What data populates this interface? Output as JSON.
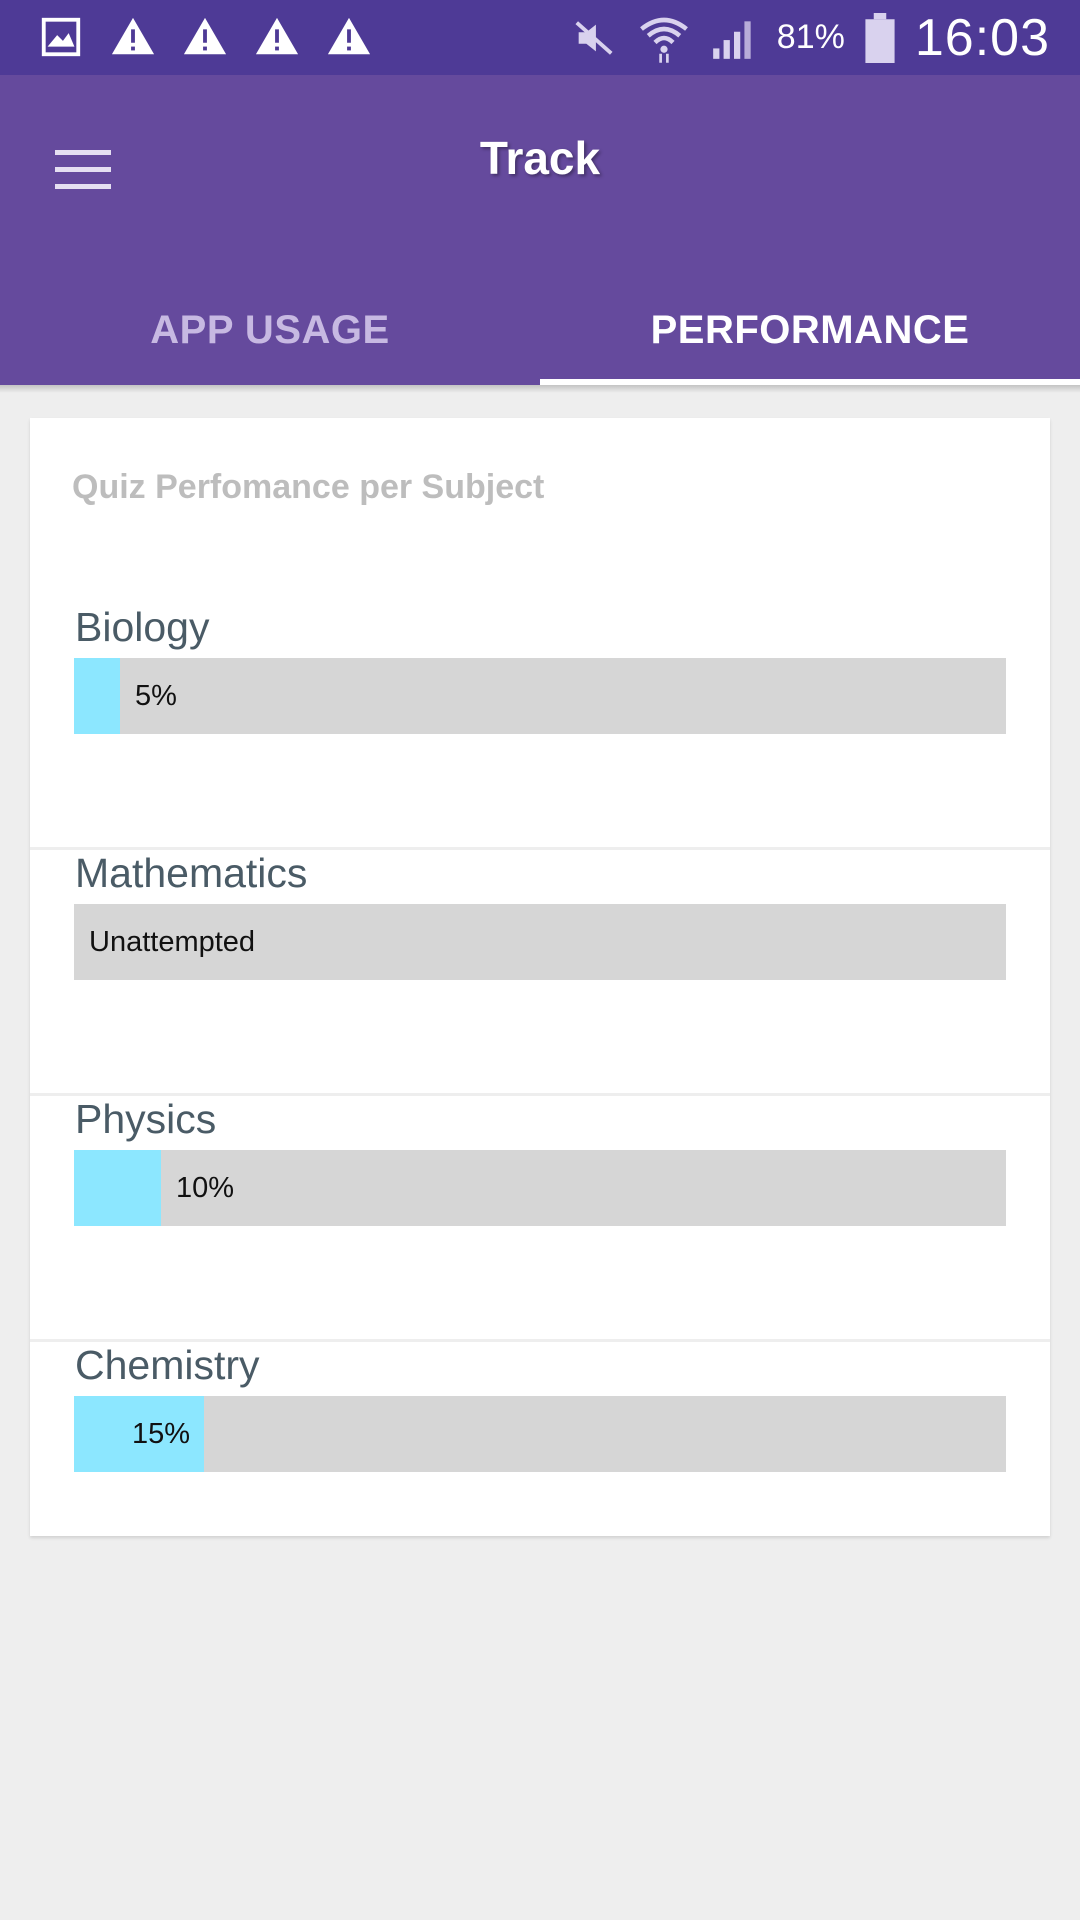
{
  "status_bar": {
    "left_icons": [
      "gallery-icon",
      "warning-icon",
      "warning-icon",
      "warning-icon",
      "warning-icon"
    ],
    "right_icons": [
      "mute-icon",
      "wifi-icon",
      "signal-icon"
    ],
    "battery_percent": "81%",
    "time": "16:03"
  },
  "app_bar": {
    "title": "Track",
    "menu_icon": "hamburger-menu-icon",
    "tabs": [
      {
        "label": "APP USAGE",
        "active": false
      },
      {
        "label": "PERFORMANCE",
        "active": true
      }
    ]
  },
  "card": {
    "title": "Quiz Perfomance per Subject",
    "subjects": [
      {
        "name": "Biology",
        "label": "5%",
        "fraction": 0.05
      },
      {
        "name": "Mathematics",
        "label": "Unattempted",
        "fraction": 0
      },
      {
        "name": "Physics",
        "label": "10%",
        "fraction": 0.1
      },
      {
        "name": "Chemistry",
        "label": "15%",
        "fraction": 0.15
      }
    ]
  },
  "colors": {
    "status_bar": "#4e3a96",
    "app_bar": "#654a9d",
    "progress_fill": "#8ce7ff",
    "progress_track": "#d6d6d6"
  }
}
